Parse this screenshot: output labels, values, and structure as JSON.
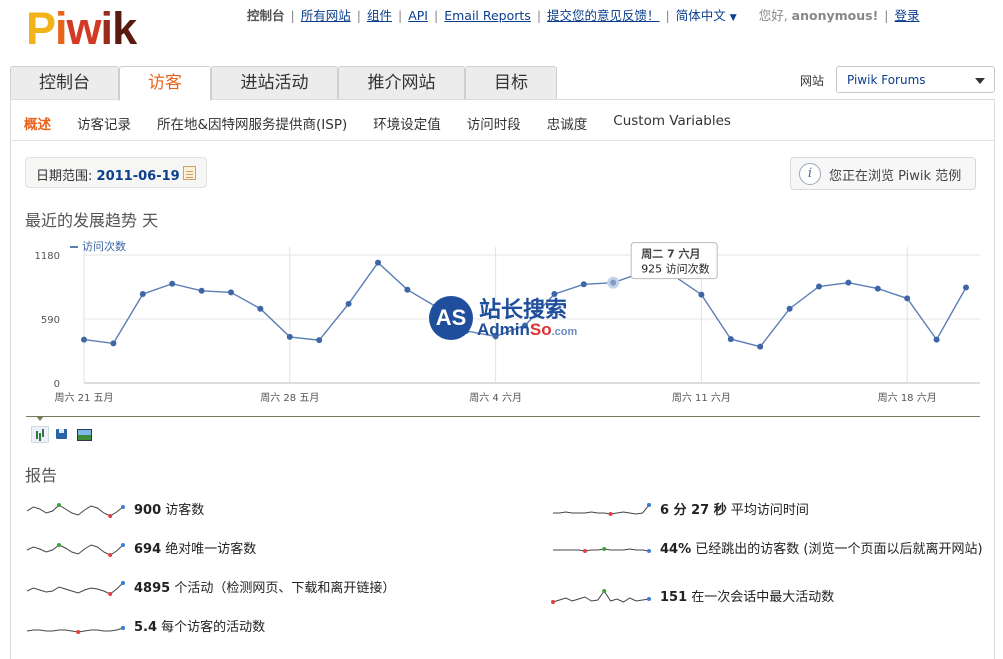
{
  "logo": {
    "text": "Piwik",
    "parts": [
      "P",
      "i",
      "w",
      "i",
      "k"
    ]
  },
  "topnav": {
    "dashboard": "控制台",
    "all_sites": "所有网站",
    "widgets": "组件",
    "api": "API",
    "email_reports": "Email Reports",
    "feedback": "提交您的意见反馈！",
    "language": "简体中文",
    "greeting": "您好,",
    "user": "anonymous!",
    "login": "登录"
  },
  "tabs": [
    "控制台",
    "访客",
    "进站活动",
    "推介网站",
    "目标"
  ],
  "active_tab": 1,
  "site_selector": {
    "label": "网站",
    "value": "Piwik Forums"
  },
  "subnav": [
    "概述",
    "访客记录",
    "所在地&因特网服务提供商(ISP)",
    "环境设定值",
    "访问时段",
    "忠诚度",
    "Custom Variables"
  ],
  "date_range": {
    "label": "日期范围:",
    "value": "2011-06-19"
  },
  "demo_notice": "您正在浏览 Piwik 范例",
  "evolution_title": "最近的发展趋势 天",
  "report_title": "报告",
  "watermark": {
    "logo": "AS",
    "main": "站长搜索",
    "sub_a": "Admin",
    "sub_b": "So",
    "sub_c": ".com"
  },
  "chart_data": {
    "type": "line",
    "legend": [
      "访问次数"
    ],
    "y_ticks": [
      "1180",
      "590",
      "0"
    ],
    "ylim": [
      0,
      1180
    ],
    "x_labels": [
      "周六 21 五月",
      "周六 28 五月",
      "周六 4 六月",
      "周六 11 六月",
      "周六 18 六月"
    ],
    "series": [
      {
        "name": "访问次数",
        "values": [
          400,
          365,
          820,
          915,
          850,
          835,
          685,
          425,
          395,
          730,
          1110,
          860,
          700,
          480,
          430,
          530,
          820,
          910,
          925,
          1020,
          1000,
          815,
          405,
          335,
          685,
          890,
          925,
          870,
          780,
          400,
          880
        ]
      }
    ],
    "tooltip": {
      "title": "周二 7 六月",
      "value": "925",
      "label": "访问次数"
    },
    "grid": true,
    "legend_position": "top-left"
  },
  "sparklines": [
    {
      "value": "900",
      "label": "访客数"
    },
    {
      "value": "694",
      "label": "绝对唯一访客数"
    },
    {
      "value": "4895",
      "label": "个活动（检测网页、下载和离开链接）"
    },
    {
      "value": "5.4",
      "label": "每个访客的活动数"
    },
    {
      "value": "6 分 27 秒",
      "label": "平均访问时间"
    },
    {
      "value": "44%",
      "label": "已经跳出的访客数 (浏览一个页面以后就离开网站)"
    },
    {
      "value": "151",
      "label": "在一次会话中最大活动数"
    }
  ],
  "colors": {
    "accent": "#e8641b",
    "link": "#0b3e8c",
    "line": "#5b7fb4",
    "point": "#3e66a6"
  }
}
